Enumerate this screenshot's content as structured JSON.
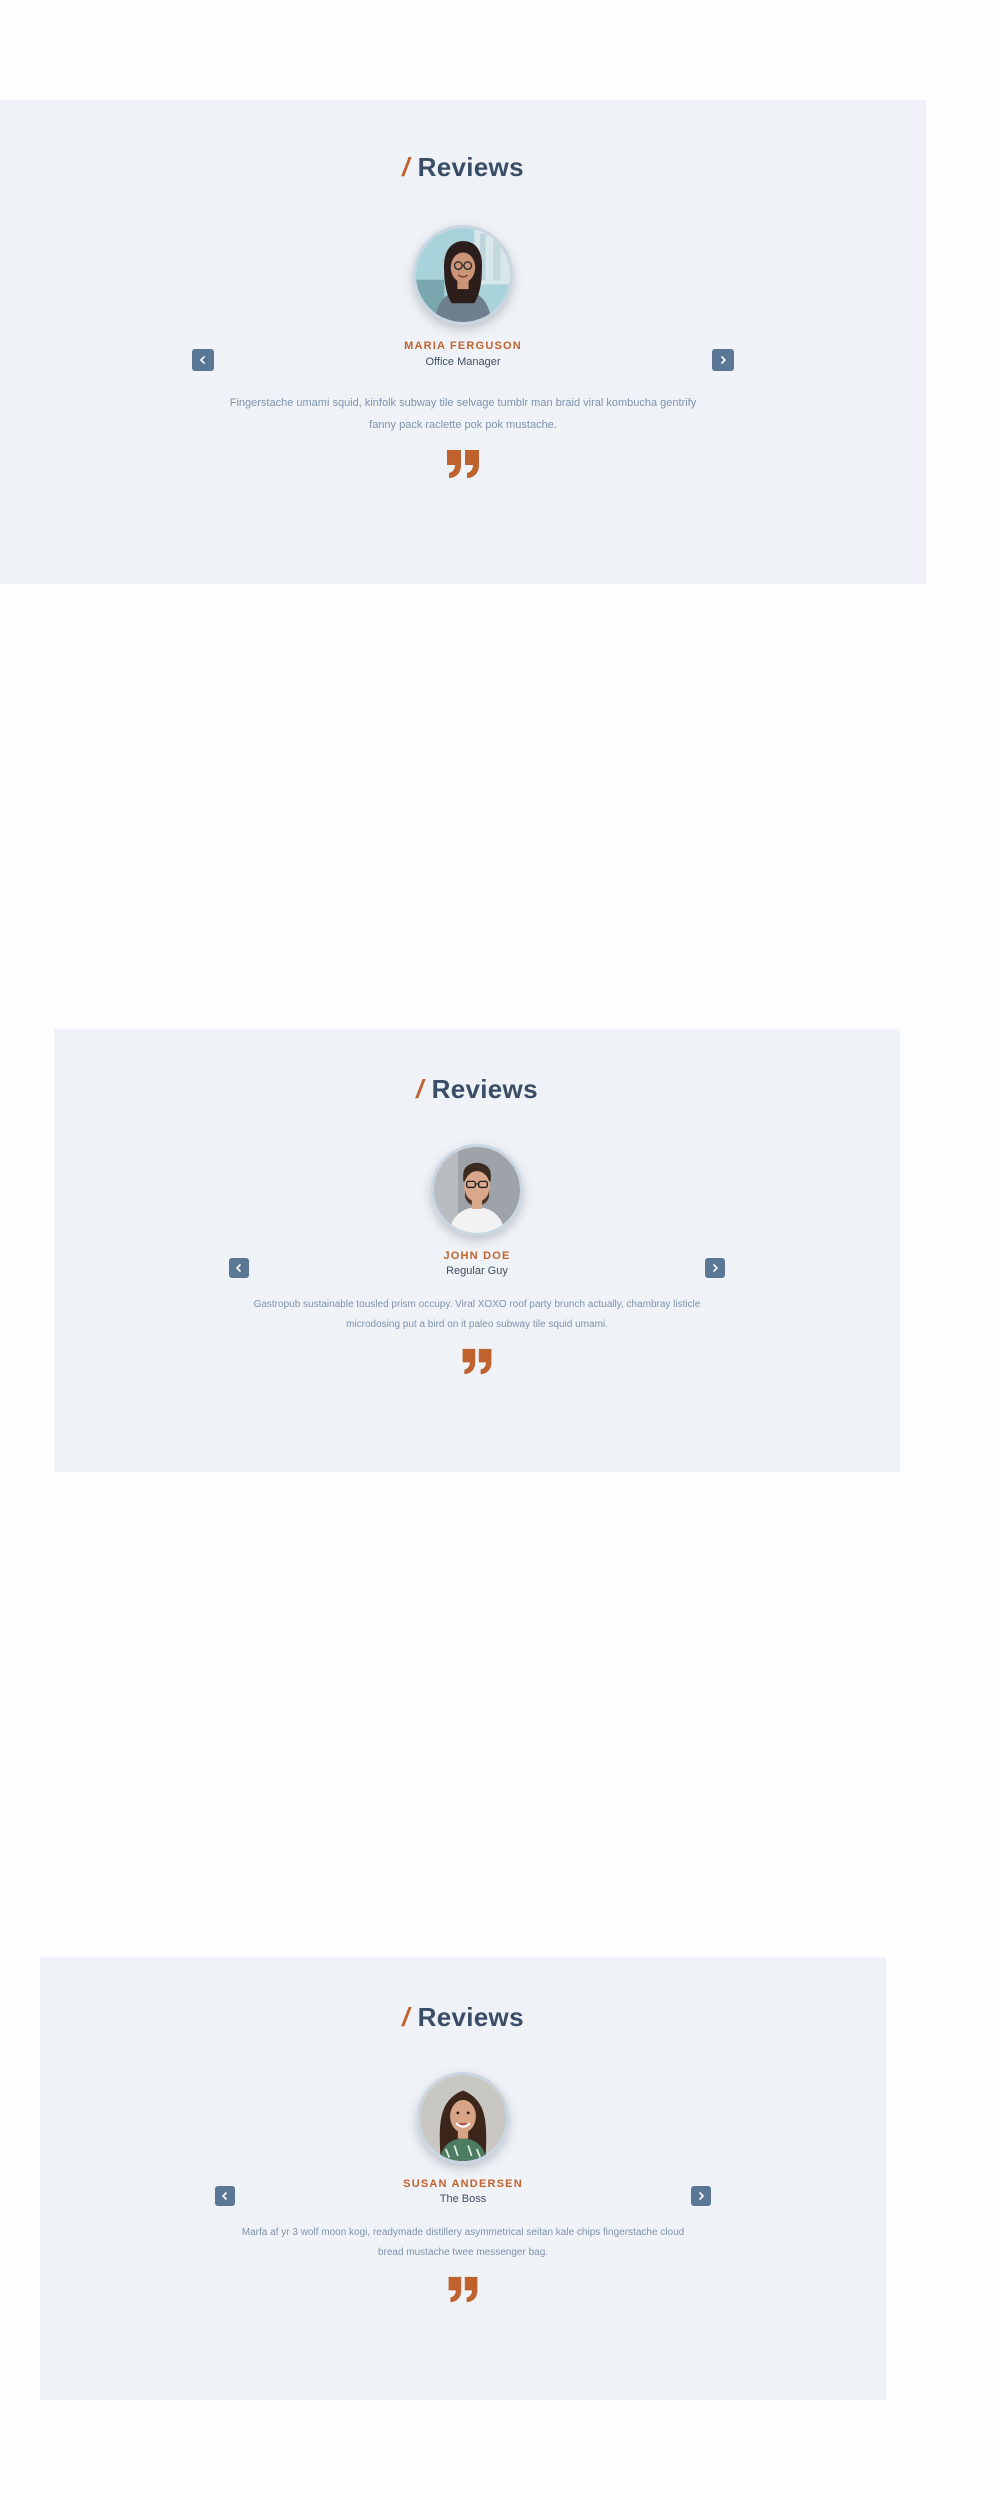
{
  "sections": [
    {
      "heading_slash": "/",
      "heading": "Reviews",
      "name": "MARIA FERGUSON",
      "role": "Office Manager",
      "text": "Fingerstache umami squid, kinfolk subway tile selvage tumblr man braid viral kombucha gentrify fanny pack raclette pok pok mustache.",
      "avatar_icon": "woman-with-glasses-photo",
      "prev_icon": "chevron-left-icon",
      "next_icon": "chevron-right-icon",
      "quote_icon": "quote-icon"
    },
    {
      "heading_slash": "/",
      "heading": "Reviews",
      "name": "JOHN DOE",
      "role": "Regular Guy",
      "text": "Gastropub sustainable tousled prism occupy. Viral XOXO roof party brunch actually, chambray listicle microdosing put a bird on it paleo subway tile squid umami.",
      "avatar_icon": "bearded-man-photo",
      "prev_icon": "chevron-left-icon",
      "next_icon": "chevron-right-icon",
      "quote_icon": "quote-icon"
    },
    {
      "heading_slash": "/",
      "heading": "Reviews",
      "name": "SUSAN ANDERSEN",
      "role": "The Boss",
      "text": "Marfa af yr 3 wolf moon kogi, readymade distillery asymmetrical seitan kale chips fingerstache cloud bread mustache twee messenger bag.",
      "avatar_icon": "smiling-woman-photo",
      "prev_icon": "chevron-left-icon",
      "next_icon": "chevron-right-icon",
      "quote_icon": "quote-icon"
    }
  ],
  "colors": {
    "section_bg": "#eff2f6",
    "accent": "#c0622d",
    "heading": "#3a4d66",
    "button": "#5b7796",
    "body_text": "#7e93ad"
  }
}
